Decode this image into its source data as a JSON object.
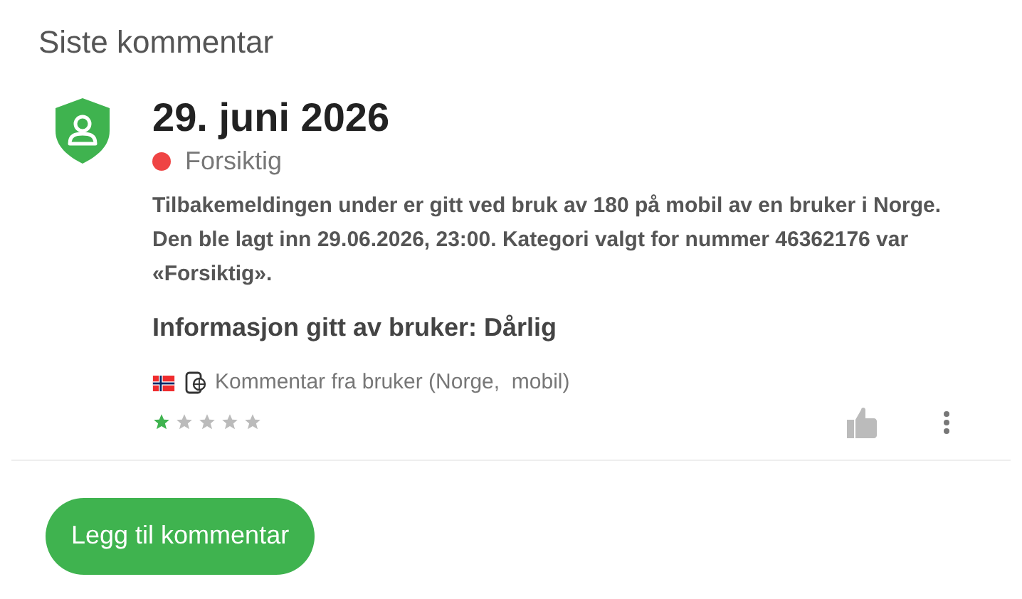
{
  "title": "Siste kommentar",
  "comment": {
    "date": "29. juni 2026",
    "category": {
      "label": "Forsiktig",
      "color": "#ef4444"
    },
    "text": "Tilbakemeldingen under er gitt ved bruk av 180 på mobil av en bruker i Norge. Den ble lagt inn 29.06.2026, 23:00. Kategori valgt for nummer 46362176 var «Forsiktig».",
    "info": "Informasjon gitt av bruker: Dårlig",
    "source": "Kommentar fra bruker (Norge,  mobil)",
    "stars": 1
  },
  "add_button": "Legg til kommentar"
}
